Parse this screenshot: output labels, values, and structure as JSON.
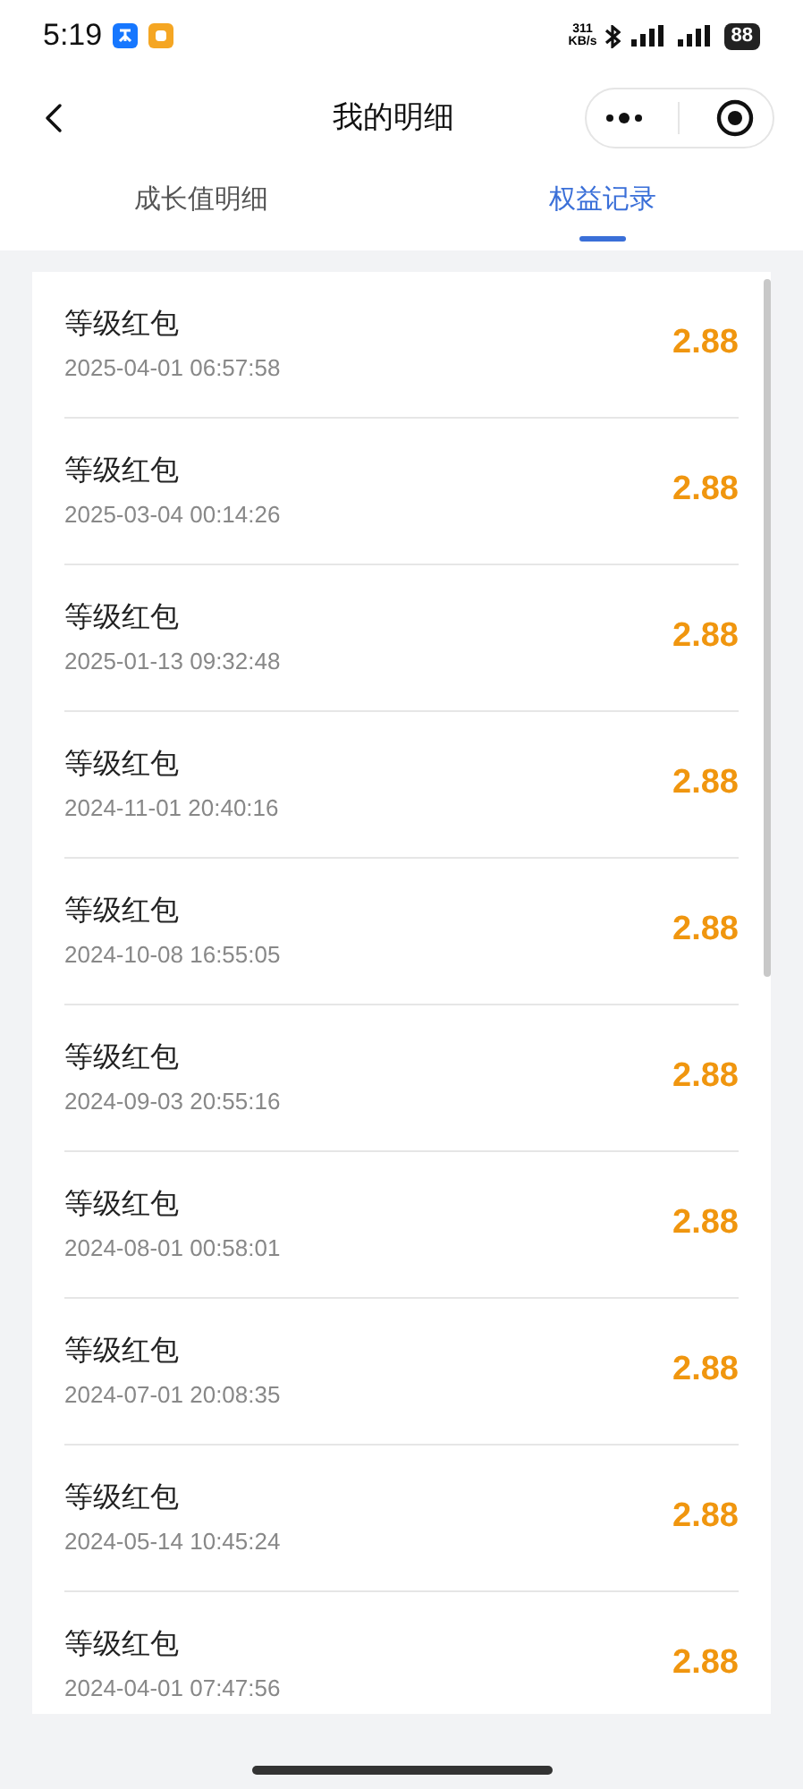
{
  "status_bar": {
    "time": "5:19",
    "speed": "311\nKB/s",
    "battery": "88"
  },
  "nav": {
    "title": "我的明细"
  },
  "tabs": [
    {
      "label": "成长值明细",
      "selected": false
    },
    {
      "label": "权益记录",
      "selected": true
    }
  ],
  "records": [
    {
      "title": "等级红包",
      "time": "2025-04-01 06:57:58",
      "amount": "2.88"
    },
    {
      "title": "等级红包",
      "time": "2025-03-04 00:14:26",
      "amount": "2.88"
    },
    {
      "title": "等级红包",
      "time": "2025-01-13 09:32:48",
      "amount": "2.88"
    },
    {
      "title": "等级红包",
      "time": "2024-11-01 20:40:16",
      "amount": "2.88"
    },
    {
      "title": "等级红包",
      "time": "2024-10-08 16:55:05",
      "amount": "2.88"
    },
    {
      "title": "等级红包",
      "time": "2024-09-03 20:55:16",
      "amount": "2.88"
    },
    {
      "title": "等级红包",
      "time": "2024-08-01 00:58:01",
      "amount": "2.88"
    },
    {
      "title": "等级红包",
      "time": "2024-07-01 20:08:35",
      "amount": "2.88"
    },
    {
      "title": "等级红包",
      "time": "2024-05-14 10:45:24",
      "amount": "2.88"
    },
    {
      "title": "等级红包",
      "time": "2024-04-01 07:47:56",
      "amount": "2.88"
    }
  ]
}
